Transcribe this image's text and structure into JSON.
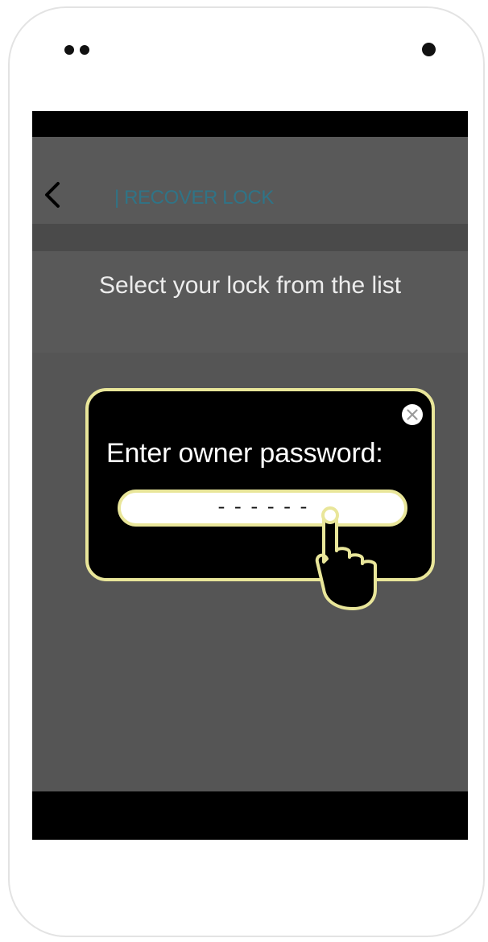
{
  "header": {
    "title": "| RECOVER LOCK",
    "back_icon": "chevron-left-icon"
  },
  "instruction": {
    "text": "Select your lock from the list"
  },
  "dialog": {
    "title": "Enter owner password:",
    "password_placeholder": "------",
    "close_icon": "close-circle-icon",
    "hint_icon": "pointing-hand-icon"
  },
  "colors": {
    "accent_title": "#2f7487",
    "dialog_border": "#e9e69a",
    "screen_background": "#575757"
  }
}
